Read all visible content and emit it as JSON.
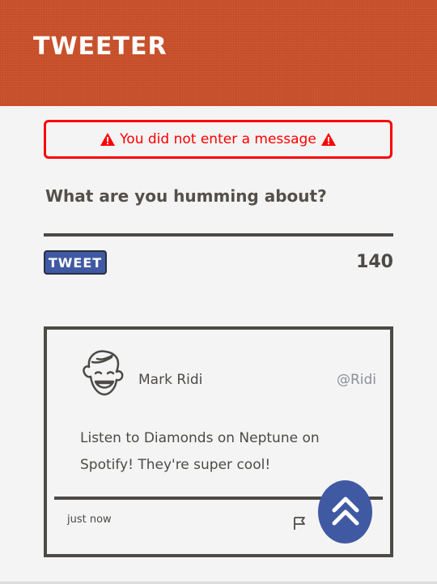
{
  "app": {
    "brand": "Tweeter"
  },
  "compose": {
    "error_message": "You did not enter a message",
    "prompt": "What are you humming about?",
    "tweet_button_label": "Tweet",
    "char_counter": "140"
  },
  "tweet": {
    "user_name": "Mark Ridi",
    "user_handle": "@Ridi",
    "text": "Listen to Diamonds on Neptune on Spotify! They're super cool!",
    "timestamp": "just now"
  },
  "colors": {
    "header": "#c9502a",
    "error": "#ff0000",
    "accent": "#4059a3",
    "text": "#4c4a45",
    "handle": "#8b8f9c"
  },
  "icons": {
    "error": "warning-icon",
    "avatar": "smiling-face-avatar",
    "flag": "flag-icon",
    "scroll_top": "double-chevron-up-icon"
  }
}
